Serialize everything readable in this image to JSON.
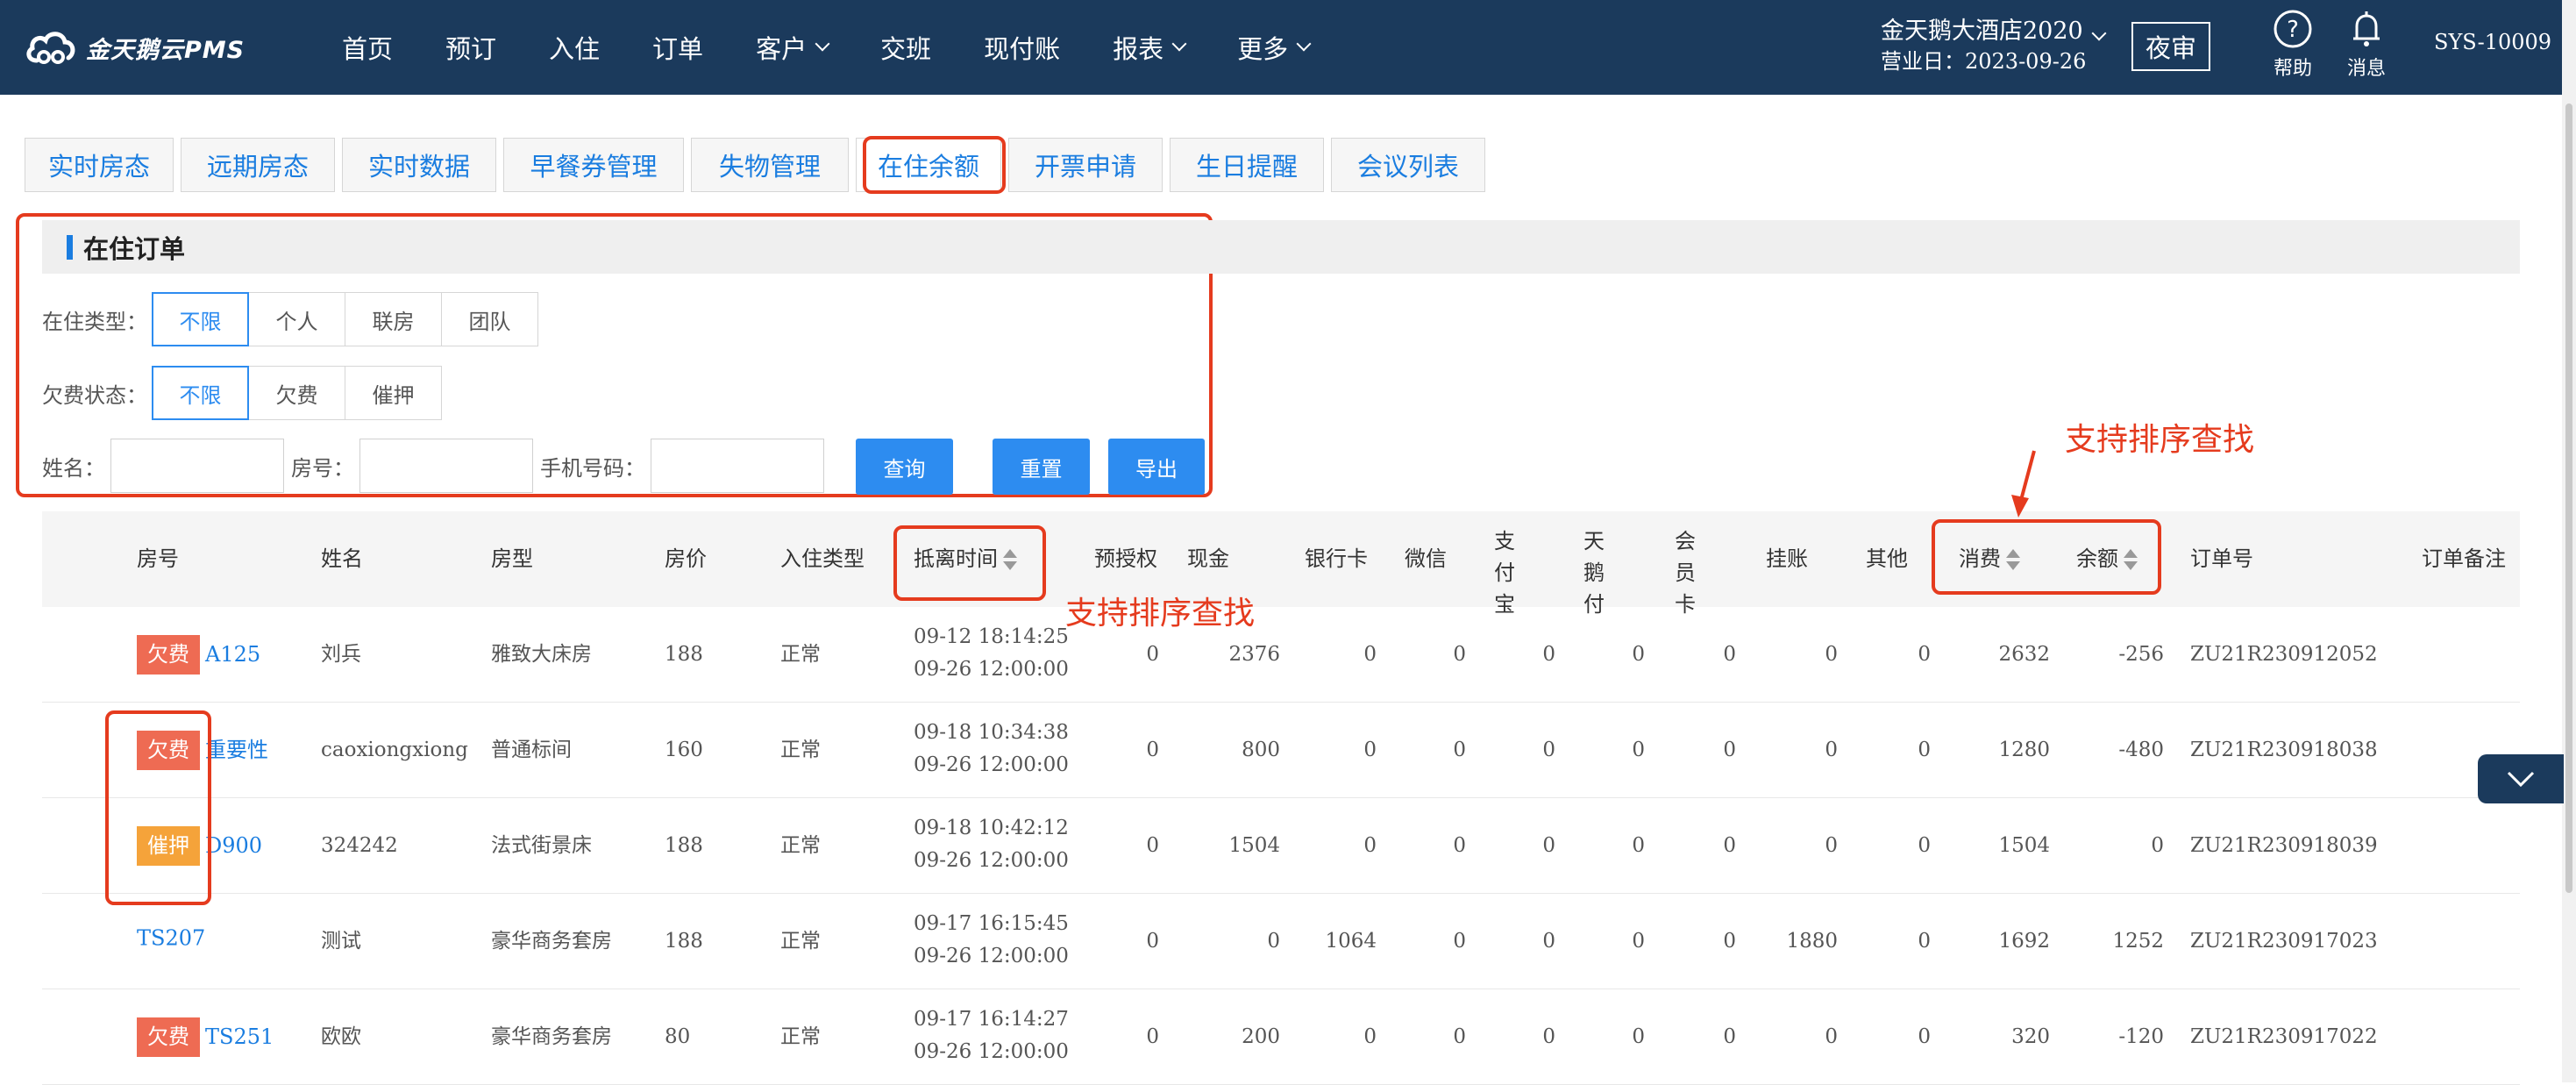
{
  "app": {
    "logo_text": "金天鹅云PMS",
    "nav": [
      {
        "label": "首页",
        "dropdown": false
      },
      {
        "label": "预订",
        "dropdown": false
      },
      {
        "label": "入住",
        "dropdown": false
      },
      {
        "label": "订单",
        "dropdown": false
      },
      {
        "label": "客户",
        "dropdown": true
      },
      {
        "label": "交班",
        "dropdown": false
      },
      {
        "label": "现付账",
        "dropdown": false
      },
      {
        "label": "报表",
        "dropdown": true
      },
      {
        "label": "更多",
        "dropdown": true
      }
    ],
    "hotel_name": "金天鹅大酒店2020",
    "business_date": "营业日：2023-09-26",
    "night_audit": "夜审",
    "help_label": "帮助",
    "message_label": "消息",
    "user": "SYS-10009"
  },
  "tabs": [
    "实时房态",
    "远期房态",
    "实时数据",
    "早餐券管理",
    "失物管理",
    "在住余额",
    "开票申请",
    "生日提醒",
    "会议列表"
  ],
  "active_tab": "在住余额",
  "filter": {
    "title": "在住订单",
    "stay_type_label": "在住类型：",
    "stay_type_options": [
      "不限",
      "个人",
      "联房",
      "团队"
    ],
    "stay_type_selected": "不限",
    "arrears_label": "欠费状态：",
    "arrears_options": [
      "不限",
      "欠费",
      "催押"
    ],
    "arrears_selected": "不限",
    "name_label": "姓名：",
    "room_label": "房号：",
    "phone_label": "手机号码：",
    "name_value": "",
    "room_value": "",
    "phone_value": "",
    "query_button": "查询",
    "reset_button": "重置",
    "export_button": "导出"
  },
  "table": {
    "columns": [
      "房号",
      "姓名",
      "房型",
      "房价",
      "入住类型",
      "抵离时间",
      "预授权",
      "现金",
      "银行卡",
      "微信",
      "支付宝",
      "天鹅付",
      "会员卡",
      "挂账",
      "其他",
      "消费",
      "余额",
      "订单号",
      "订单备注"
    ],
    "rows": [
      {
        "tag": "欠费",
        "tag_color": "#ee6b53",
        "room": "A125",
        "name": "刘兵",
        "room_type": "雅致大床房",
        "price": "188",
        "stay_type": "正常",
        "arrive": "09-12 18:14:25",
        "depart": "09-26 12:00:00",
        "preauth": "0",
        "cash": "2376",
        "bank": "0",
        "wechat": "0",
        "alipay": "0",
        "swanpay": "0",
        "member": "0",
        "credit": "0",
        "other": "0",
        "consume": "2632",
        "balance": "-256",
        "order_no": "ZU21R230912052"
      },
      {
        "tag": "欠费",
        "tag_color": "#ee6b53",
        "room": "重要性",
        "name": "caoxiongxiong",
        "room_type": "普通标间",
        "price": "160",
        "stay_type": "正常",
        "arrive": "09-18 10:34:38",
        "depart": "09-26 12:00:00",
        "preauth": "0",
        "cash": "800",
        "bank": "0",
        "wechat": "0",
        "alipay": "0",
        "swanpay": "0",
        "member": "0",
        "credit": "0",
        "other": "0",
        "consume": "1280",
        "balance": "-480",
        "order_no": "ZU21R230918038"
      },
      {
        "tag": "催押",
        "tag_color": "#f5a33a",
        "room": "D900",
        "name": "324242",
        "room_type": "法式街景床",
        "price": "188",
        "stay_type": "正常",
        "arrive": "09-18 10:42:12",
        "depart": "09-26 12:00:00",
        "preauth": "0",
        "cash": "1504",
        "bank": "0",
        "wechat": "0",
        "alipay": "0",
        "swanpay": "0",
        "member": "0",
        "credit": "0",
        "other": "0",
        "consume": "1504",
        "balance": "0",
        "order_no": "ZU21R230918039"
      },
      {
        "tag": "",
        "tag_color": "",
        "room": "TS207",
        "name": "测试",
        "room_type": "豪华商务套房",
        "price": "188",
        "stay_type": "正常",
        "arrive": "09-17 16:15:45",
        "depart": "09-26 12:00:00",
        "preauth": "0",
        "cash": "0",
        "bank": "1064",
        "wechat": "0",
        "alipay": "0",
        "swanpay": "0",
        "member": "0",
        "credit": "1880",
        "other": "0",
        "consume": "1692",
        "balance": "1252",
        "order_no": "ZU21R230917023"
      },
      {
        "tag": "欠费",
        "tag_color": "#ee6b53",
        "room": "TS251",
        "name": "欧欧",
        "room_type": "豪华商务套房",
        "price": "80",
        "stay_type": "正常",
        "arrive": "09-17 16:14:27",
        "depart": "09-26 12:00:00",
        "preauth": "0",
        "cash": "200",
        "bank": "0",
        "wechat": "0",
        "alipay": "0",
        "swanpay": "0",
        "member": "0",
        "credit": "0",
        "other": "0",
        "consume": "320",
        "balance": "-120",
        "order_no": "ZU21R230917022"
      }
    ]
  },
  "annotations": {
    "sort_note_1": "支持排序查找",
    "sort_note_2": "支持排序查找"
  },
  "colors": {
    "topbar": "#1b3a5c",
    "accent": "#2d8cf0",
    "highlight": "#e53b1e",
    "arrears": "#ee6b53",
    "deposit": "#f5a33a"
  }
}
